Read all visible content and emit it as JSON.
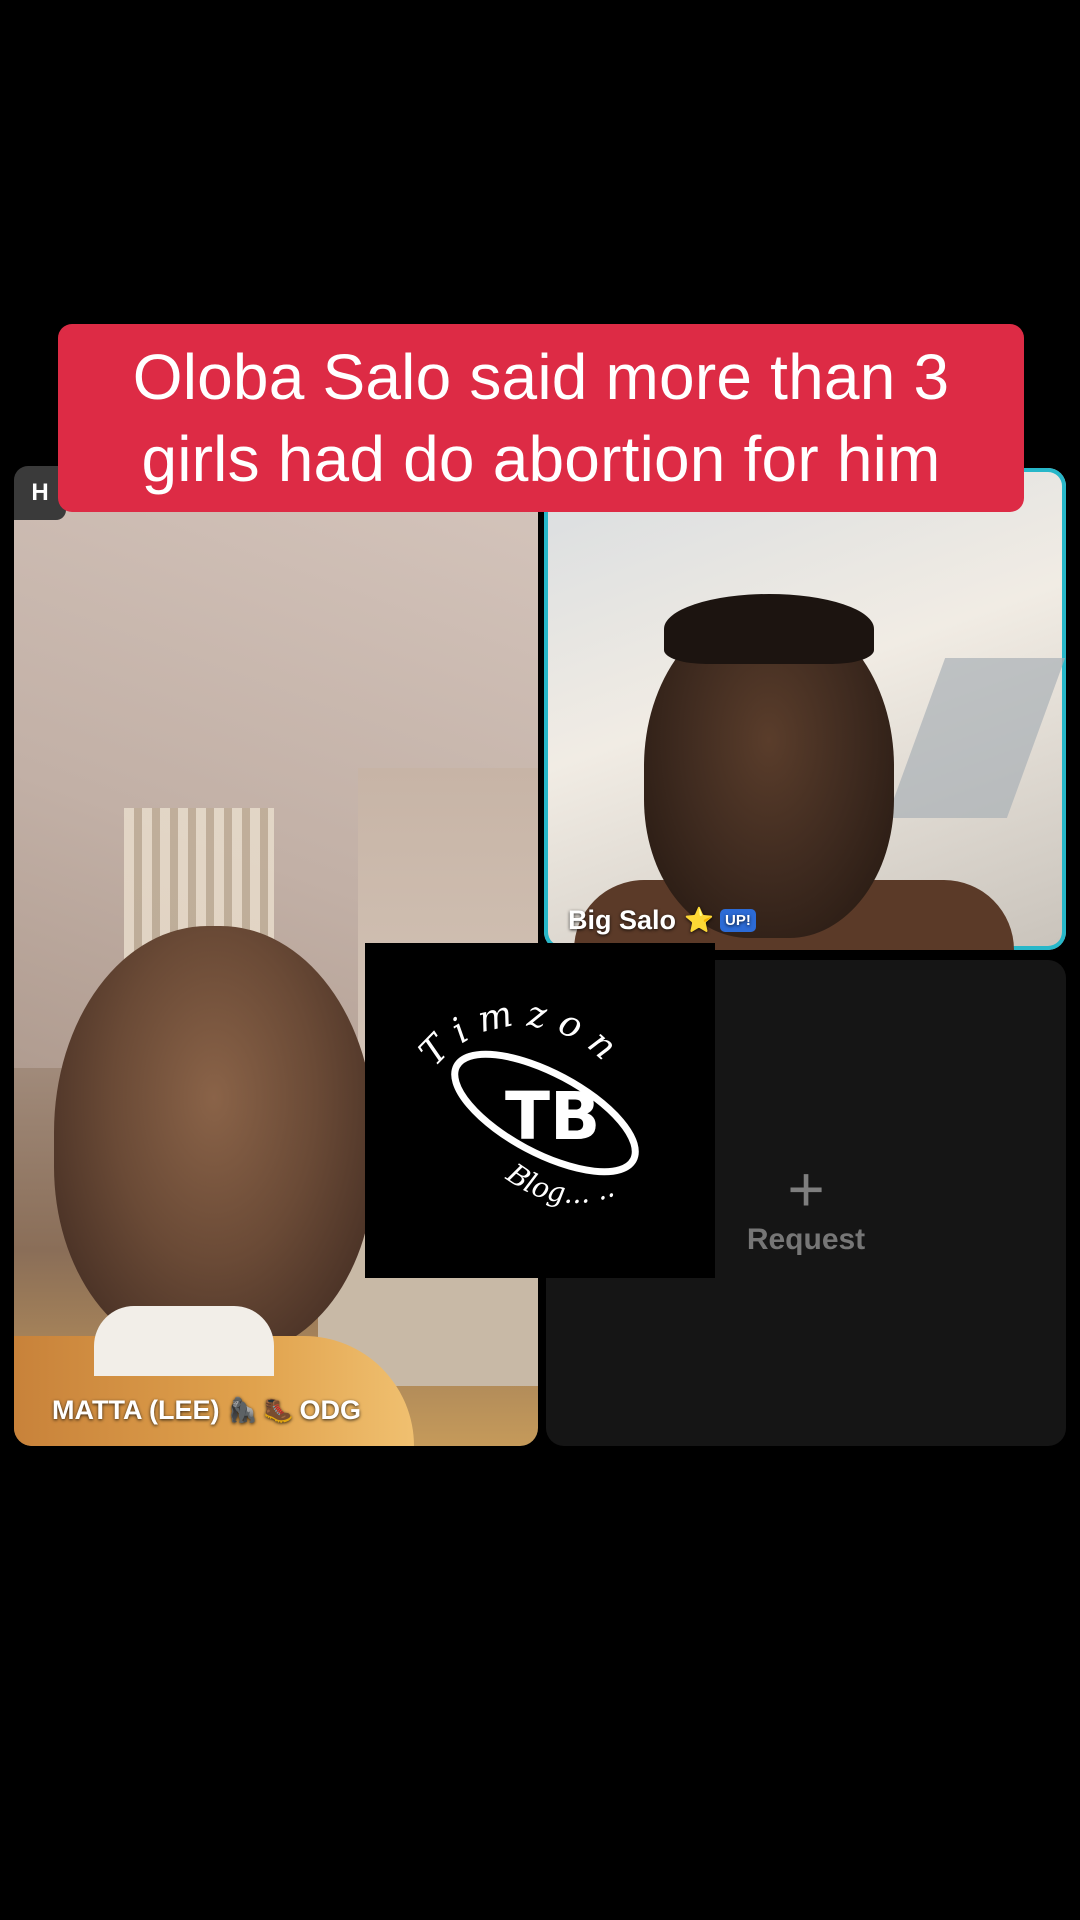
{
  "caption": {
    "line1": "Oloba Salo said more than 3",
    "line2": "girls had do abortion for him"
  },
  "host_chip": {
    "label": "H"
  },
  "participants": [
    {
      "name": "MATTA (LEE)",
      "suffix": "ODG",
      "badges": [
        "gorilla-emoji",
        "boot-emoji"
      ]
    },
    {
      "name": "Big Salo",
      "badges": [
        "star-emoji",
        "up-badge"
      ],
      "up_badge_text": "UP!"
    }
  ],
  "request_tile": {
    "icon": "plus-icon",
    "label": "Request"
  },
  "watermark": {
    "brand": "Timzon",
    "monogram": "TB",
    "sub": "Blog"
  },
  "colors": {
    "caption_bg": "#dd2b45",
    "active_speaker_border": "#27b7c9",
    "background": "#000000"
  }
}
